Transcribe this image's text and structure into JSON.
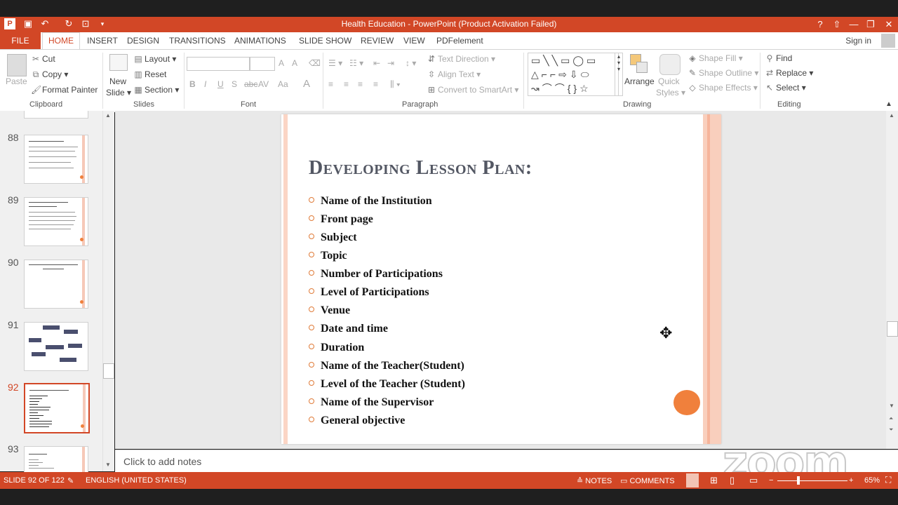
{
  "window": {
    "title": "Health Education -  PowerPoint (Product Activation Failed)",
    "help": "?",
    "minimize": "—",
    "restore": "❐",
    "close": "✕",
    "user": "Sign in"
  },
  "tabs": [
    "FILE",
    "HOME",
    "INSERT",
    "DESIGN",
    "TRANSITIONS",
    "ANIMATIONS",
    "SLIDE SHOW",
    "REVIEW",
    "VIEW",
    "PDFelement"
  ],
  "ribbon": {
    "clipboard": {
      "paste": "Paste",
      "cut": "Cut",
      "copy": "Copy",
      "format_painter": "Format Painter",
      "label": "Clipboard"
    },
    "slides": {
      "new": "New",
      "slide": "Slide",
      "layout": "Layout",
      "reset": "Reset",
      "section": "Section",
      "label": "Slides"
    },
    "font": {
      "bold": "B",
      "italic": "I",
      "underline": "U",
      "strike": "S",
      "spacing": "AV",
      "case": "Aa",
      "color": "A",
      "grow": "A",
      "shrink": "A",
      "label": "Font"
    },
    "paragraph": {
      "text_direction": "Text Direction",
      "align_text": "Align Text",
      "smartart": "Convert to SmartArt",
      "label": "Paragraph"
    },
    "drawing": {
      "arrange": "Arrange",
      "quick": "Quick",
      "styles": "Styles",
      "shape_fill": "Shape Fill",
      "shape_outline": "Shape Outline",
      "shape_effects": "Shape Effects",
      "label": "Drawing"
    },
    "editing": {
      "find": "Find",
      "replace": "Replace",
      "select": "Select",
      "label": "Editing"
    }
  },
  "thumbnails": [
    {
      "num": "88"
    },
    {
      "num": "89"
    },
    {
      "num": "90"
    },
    {
      "num": "91"
    },
    {
      "num": "92"
    },
    {
      "num": "93"
    }
  ],
  "slide": {
    "title": "Developing Lesson Plan:",
    "bullets": [
      "Name of the Institution",
      "Front page",
      "Subject",
      "Topic",
      "Number of Participations",
      "Level of Participations",
      "Venue",
      "Date and time",
      "Duration",
      "Name of the Teacher(Student)",
      "Level of the Teacher (Student)",
      "Name of the Supervisor",
      "General objective"
    ]
  },
  "notes_placeholder": "Click to add notes",
  "watermark": "zoom",
  "status": {
    "slide_info": "SLIDE 92 OF 122",
    "language": "ENGLISH (UNITED STATES)",
    "notes": "NOTES",
    "comments": "COMMENTS",
    "zoom": "65%"
  },
  "colors": {
    "accent": "#d24726",
    "bullet": "#e07b39",
    "title": "#535763"
  }
}
